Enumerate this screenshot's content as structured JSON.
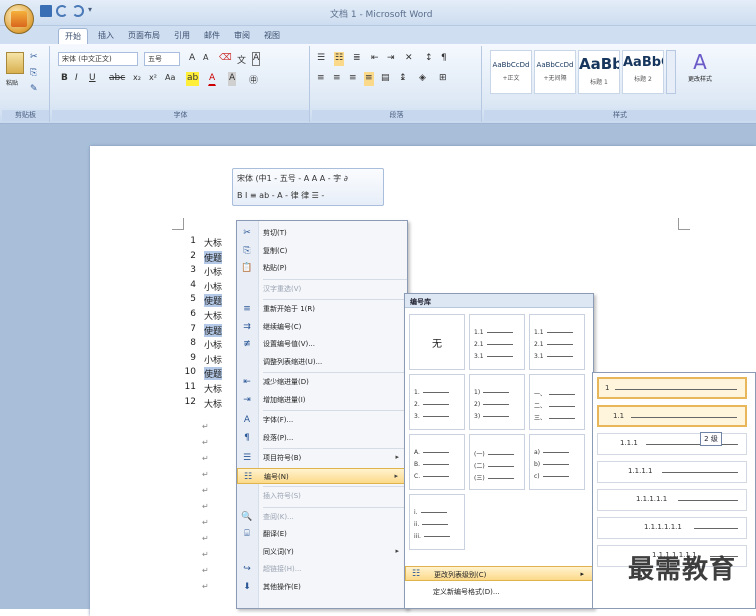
{
  "window": {
    "title": "文档 1 - Microsoft Word"
  },
  "tabs": [
    {
      "label": "开始",
      "active": true
    },
    {
      "label": "插入"
    },
    {
      "label": "页面布局"
    },
    {
      "label": "引用"
    },
    {
      "label": "邮件"
    },
    {
      "label": "审阅"
    },
    {
      "label": "视图"
    }
  ],
  "ribbon": {
    "font_name": "宋体 (中文正文)",
    "font_size": "五号",
    "groups": [
      "剪贴板",
      "字体",
      "段落",
      "样式"
    ],
    "paste_label": "粘贴",
    "styles": [
      {
        "sample": "AaBbCcDd",
        "name": "+正文"
      },
      {
        "sample": "AaBbCcDd",
        "name": "+无间隔"
      },
      {
        "sample": "AaBb",
        "name": "标题 1"
      },
      {
        "sample": "AaBbC",
        "name": "标题 2"
      }
    ],
    "change_styles": "更改样式"
  },
  "mini_toolbar": {
    "row1": "宋体 (中1 - 五号 - A A A - 字 ∂",
    "row2": "B I ≡ ab - A - 律 律 ☰ -"
  },
  "document_lines": [
    {
      "num": "1",
      "text": "大标",
      "hl": false
    },
    {
      "num": "2",
      "text": "使题",
      "hl": true
    },
    {
      "num": "3",
      "text": "小标",
      "hl": false
    },
    {
      "num": "4",
      "text": "小标",
      "hl": false
    },
    {
      "num": "5",
      "text": "使题",
      "hl": true
    },
    {
      "num": "6",
      "text": "大标",
      "hl": false
    },
    {
      "num": "7",
      "text": "使题",
      "hl": true
    },
    {
      "num": "8",
      "text": "小标",
      "hl": false
    },
    {
      "num": "9",
      "text": "小标",
      "hl": false
    },
    {
      "num": "10",
      "text": "使题",
      "hl": true
    },
    {
      "num": "11",
      "text": "大标",
      "hl": false
    },
    {
      "num": "12",
      "text": "大标",
      "hl": false
    }
  ],
  "context_menu": [
    {
      "icon": "✂",
      "label": "剪切(T)",
      "disabled": false
    },
    {
      "icon": "⎘",
      "label": "复制(C)",
      "disabled": false
    },
    {
      "icon": "📋",
      "label": "粘贴(P)",
      "disabled": false
    },
    {
      "icon": "",
      "label": "汉字重选(V)",
      "disabled": true
    },
    {
      "icon": "≡",
      "label": "重新开始于 1(R)",
      "disabled": false
    },
    {
      "icon": "⇉",
      "label": "继续编号(C)",
      "disabled": false
    },
    {
      "icon": "≢",
      "label": "设置编号值(V)...",
      "disabled": false
    },
    {
      "icon": "",
      "label": "调整列表缩进(U)...",
      "disabled": false
    },
    {
      "icon": "⇤",
      "label": "减少缩进量(D)",
      "disabled": false
    },
    {
      "icon": "⇥",
      "label": "增加缩进量(I)",
      "disabled": false
    },
    {
      "icon": "A",
      "label": "字体(F)...",
      "disabled": false
    },
    {
      "icon": "¶",
      "label": "段落(P)...",
      "disabled": false
    },
    {
      "icon": "☰",
      "label": "项目符号(B)",
      "disabled": false
    },
    {
      "icon": "☷",
      "label": "编号(N)",
      "disabled": false
    },
    {
      "icon": "",
      "label": "插入符号(S)",
      "disabled": true
    },
    {
      "icon": "🔍",
      "label": "查阅(K)...",
      "disabled": true
    },
    {
      "icon": "⌸",
      "label": "翻译(E)",
      "disabled": false
    },
    {
      "icon": "",
      "label": "同义词(Y)",
      "disabled": false
    },
    {
      "icon": "↪",
      "label": "超链接(H)...",
      "disabled": true
    },
    {
      "icon": "⬇",
      "label": "其他操作(E)",
      "disabled": false
    }
  ],
  "numbering_library": {
    "header": "编号库",
    "none_label": "无",
    "cells": [
      [
        "1.1",
        "2.1",
        "3.1"
      ],
      [
        "1.1",
        "2.1",
        "3.1"
      ],
      [
        "1.",
        "2.",
        "3."
      ],
      [
        "1)",
        "2)",
        "3)"
      ],
      [
        "一、",
        "二、",
        "三、"
      ],
      [
        "A.",
        "B.",
        "C."
      ],
      [
        "(一)",
        "(二)",
        "(三)"
      ],
      [
        "a)",
        "b)",
        "c)"
      ],
      [
        "i.",
        "ii.",
        "iii."
      ]
    ],
    "footer": [
      "更改列表级别(C)",
      "定义新编号格式(D)..."
    ]
  },
  "multilevel_list": {
    "levels": [
      "1",
      "1.1",
      "1.1.1",
      "1.1.1.1",
      "1.1.1.1.1",
      "1.1.1.1.1.1",
      "1.1.1.1.1.1.1"
    ],
    "tooltip": "2 级"
  },
  "watermark": "最需教育"
}
